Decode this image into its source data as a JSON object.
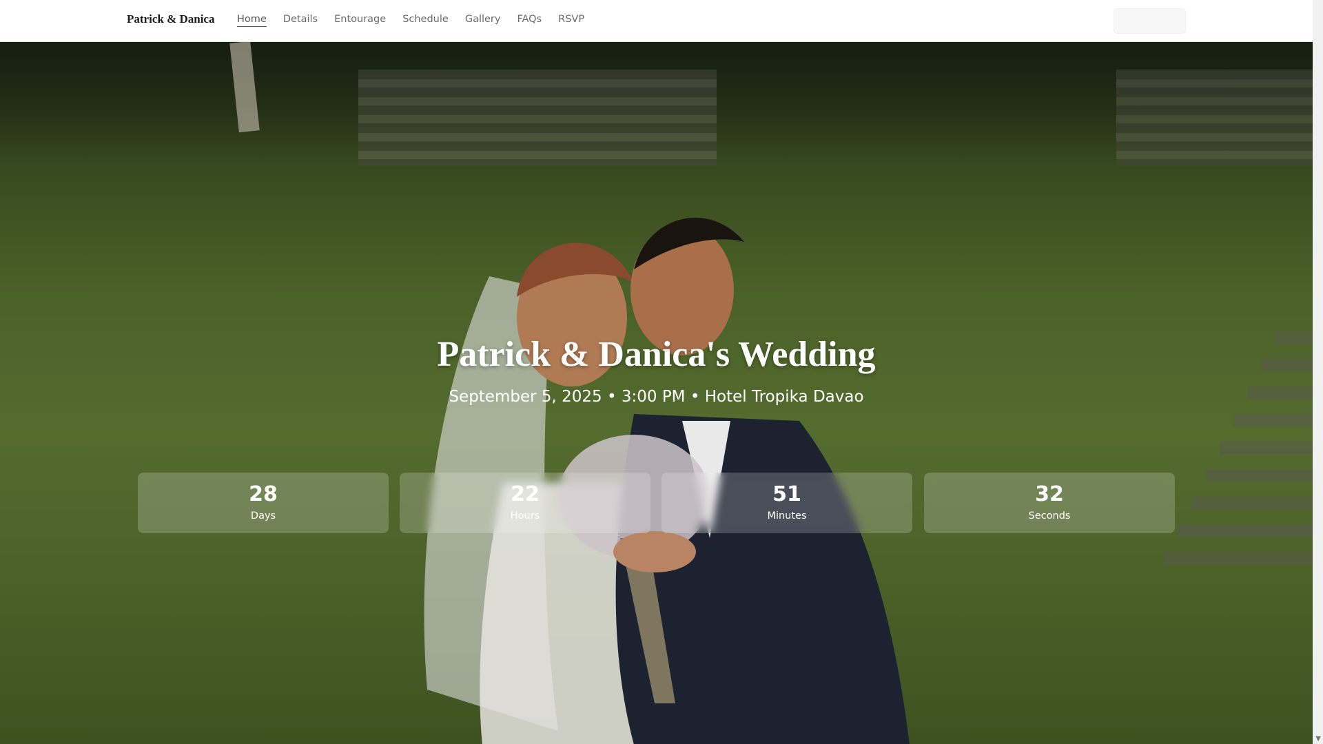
{
  "brand": "Patrick & Danica",
  "nav": {
    "links": [
      {
        "label": "Home",
        "active": true
      },
      {
        "label": "Details"
      },
      {
        "label": "Entourage"
      },
      {
        "label": "Schedule"
      },
      {
        "label": "Gallery"
      },
      {
        "label": "FAQs"
      },
      {
        "label": "RSVP"
      }
    ]
  },
  "hero": {
    "title": "Patrick & Danica's Wedding",
    "subtitle": "September 5, 2025 • 3:00 PM • Hotel Tropika Davao"
  },
  "countdown": [
    {
      "value": "28",
      "label": "Days"
    },
    {
      "value": "22",
      "label": "Hours"
    },
    {
      "value": "51",
      "label": "Minutes"
    },
    {
      "value": "32",
      "label": "Seconds"
    }
  ],
  "icons": {
    "scroll_down": "chevron-down-icon"
  },
  "colors": {
    "nav_bg": "#ffffff",
    "hero_overlay": "rgba(0,0,0,0.33)",
    "text_light": "#ffffff"
  }
}
